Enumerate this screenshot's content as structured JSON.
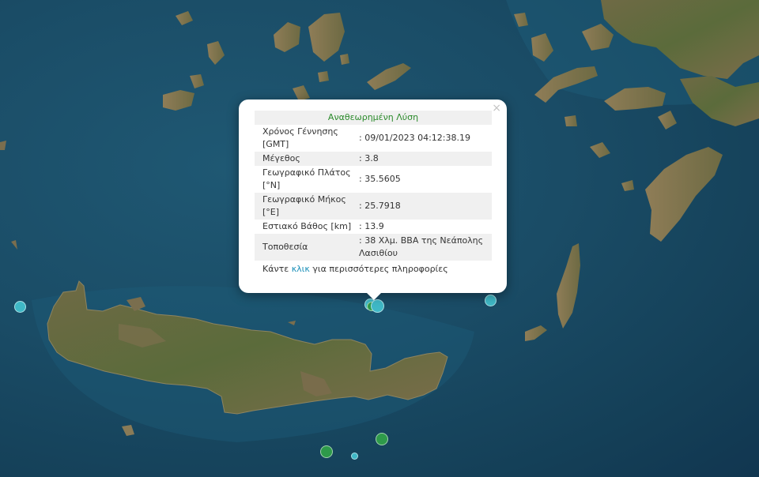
{
  "popup": {
    "title": "Αναθεωρημένη Λύση",
    "close_glyph": "×",
    "rows": [
      {
        "label": "Χρόνος Γέννησης [GMT]",
        "value": ": 09/01/2023 04:12:38.19"
      },
      {
        "label": "Μέγεθος",
        "value": ": 3.8"
      },
      {
        "label": "Γεωγραφικό Πλάτος [°N]",
        "value": ": 35.5605"
      },
      {
        "label": "Γεωγραφικό Μήκος [°E]",
        "value": ": 25.7918"
      },
      {
        "label": "Εστιακό Βάθος [km]",
        "value": ": 13.9"
      },
      {
        "label": "Τοποθεσία",
        "value": ": 38 Χλμ. ΒΒΑ της Νεάπολης Λασιθίου"
      }
    ],
    "more_prefix": "Κάντε ",
    "more_link": "κλικ",
    "more_suffix": " για περισσότερες πληροφορίες"
  },
  "markers": [
    {
      "color": "#3fb8c6",
      "selected": true
    },
    {
      "color": "#3fb8c6"
    },
    {
      "color": "#3fb8c6"
    },
    {
      "color": "#2e9a4a"
    },
    {
      "color": "#2e9a4a"
    },
    {
      "color": "#3fb8c6"
    }
  ],
  "colors": {
    "sea": "#1a4c66",
    "land_green": "#4a6a3a",
    "land_brown": "#8a7a55",
    "title_green": "#2a8a2a",
    "link": "#1a8fb8"
  }
}
